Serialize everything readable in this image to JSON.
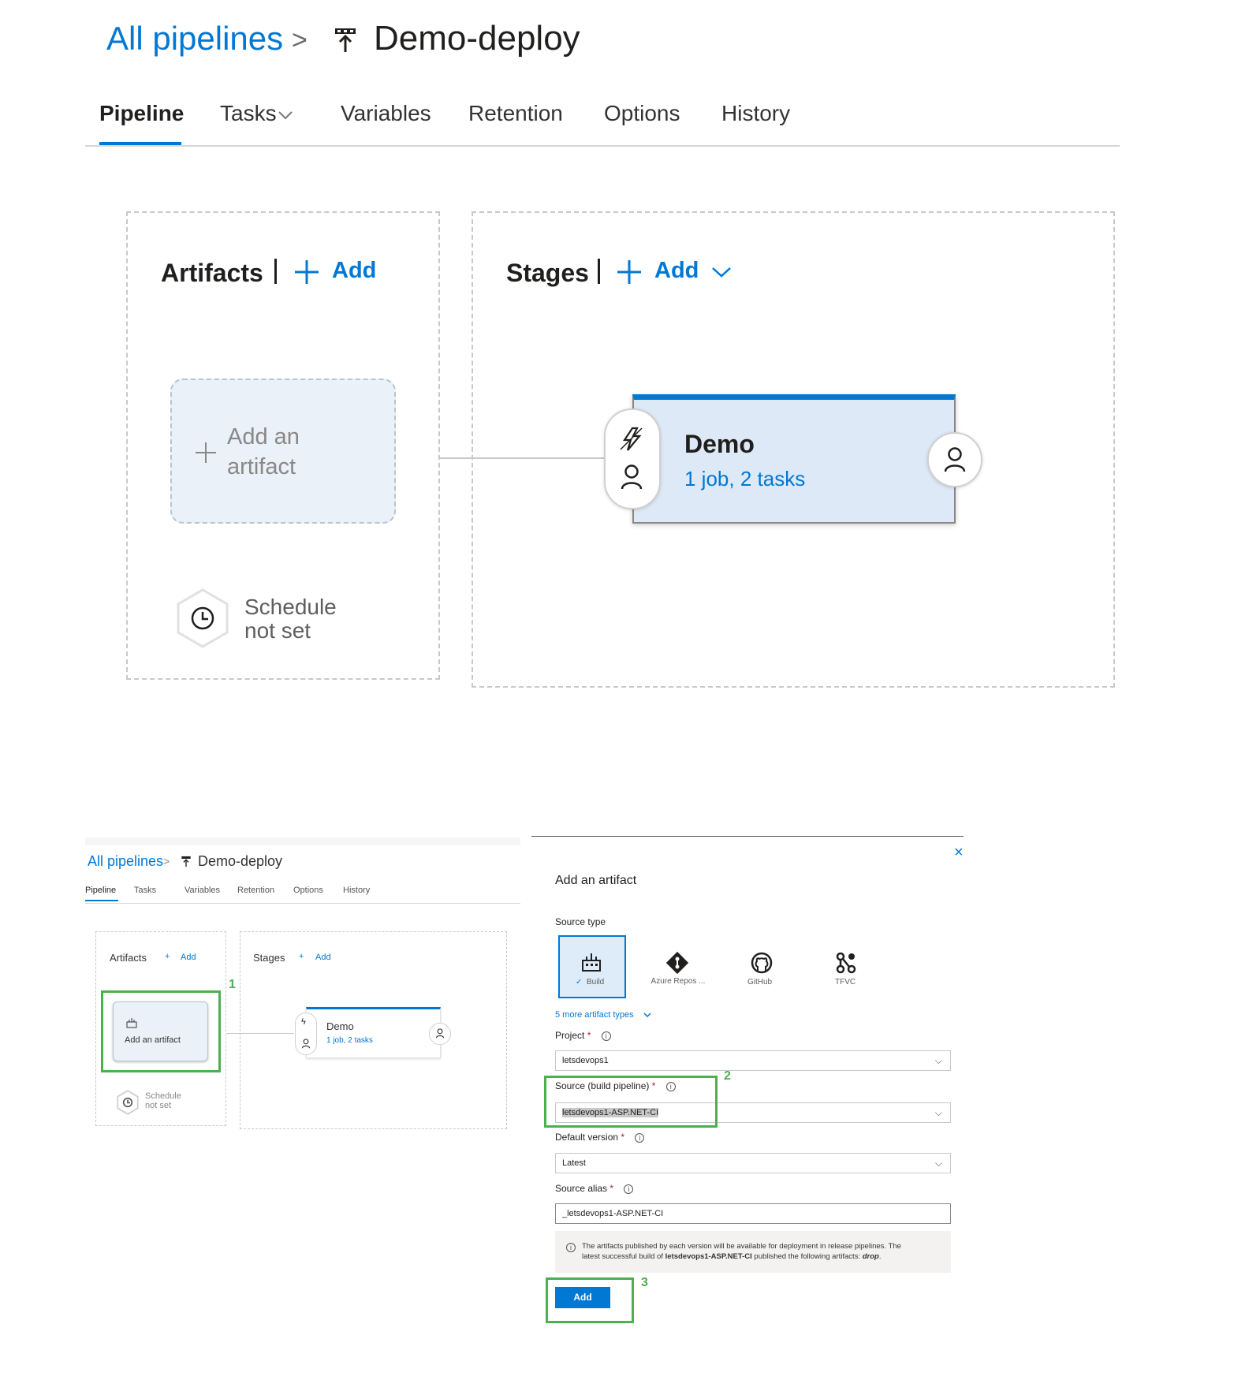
{
  "top": {
    "breadcrumb": {
      "root": "All pipelines",
      "separator": ">",
      "title": "Demo-deploy"
    },
    "tabs": [
      {
        "label": "Pipeline"
      },
      {
        "label": "Tasks"
      },
      {
        "label": "Variables"
      },
      {
        "label": "Retention"
      },
      {
        "label": "Options"
      },
      {
        "label": "History"
      }
    ],
    "artifacts": {
      "title": "Artifacts",
      "add_label": "Add",
      "add_artifact_line1": "Add an",
      "add_artifact_line2": "artifact",
      "schedule_line1": "Schedule",
      "schedule_line2": "not set"
    },
    "stages": {
      "title": "Stages",
      "add_label": "Add",
      "stage_name": "Demo",
      "stage_sub": "1 job, 2 tasks"
    }
  },
  "small": {
    "breadcrumb": {
      "root": "All pipelines",
      "separator": ">",
      "title": "Demo-deploy"
    },
    "tabs": [
      "Pipeline",
      "Tasks",
      "Variables",
      "Retention",
      "Options",
      "History"
    ],
    "artifacts": {
      "title": "Artifacts",
      "add_label": "Add",
      "add_artifact": "Add an artifact",
      "schedule_line1": "Schedule",
      "schedule_line2": "not set"
    },
    "stages": {
      "title": "Stages",
      "add_label": "Add",
      "stage_name": "Demo",
      "stage_sub": "1 job, 2 tasks"
    }
  },
  "panel": {
    "close": "×",
    "title": "Add an artifact",
    "source_type_label": "Source type",
    "source_types": [
      "Build",
      "Azure Repos ...",
      "GitHub",
      "TFVC"
    ],
    "more_types": "5 more artifact types",
    "project_label": "Project",
    "project_value": "letsdevops1",
    "source_label": "Source (build pipeline)",
    "source_value": "letsdevops1-ASP.NET-CI",
    "default_version_label": "Default version",
    "default_version_value": "Latest",
    "alias_label": "Source alias",
    "alias_value": "_letsdevops1-ASP.NET-CI",
    "note_line1": "The artifacts published by each version will be available for deployment in release pipelines. The",
    "note_line2_pre": "latest successful build of ",
    "note_line2_bold": "letsdevops1-ASP.NET-CI",
    "note_line2_mid": " published the following artifacts: ",
    "note_line2_art": "drop",
    "note_line2_end": ".",
    "add_button": "Add",
    "required_mark": "*"
  },
  "callouts": [
    "1",
    "2",
    "3"
  ],
  "colors": {
    "accent": "#0078d4",
    "callout": "#4caf50"
  }
}
